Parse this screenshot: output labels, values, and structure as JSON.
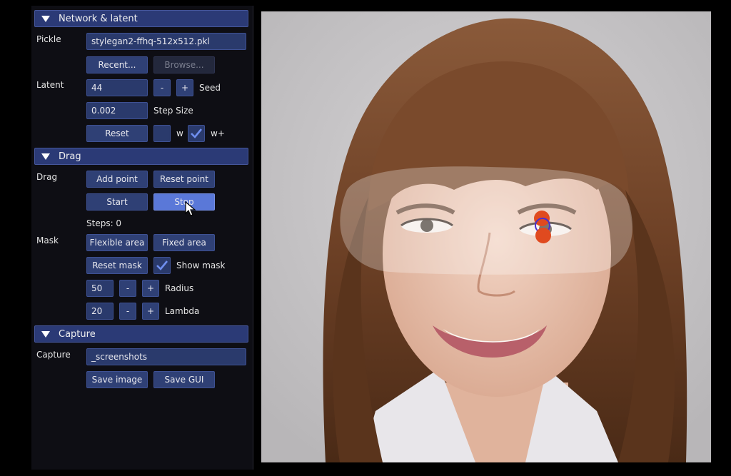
{
  "network": {
    "header": "Network & latent",
    "pickle_label": "Pickle",
    "pickle_value": "stylegan2-ffhq-512x512.pkl",
    "recent_label": "Recent...",
    "browse_label": "Browse...",
    "latent_label": "Latent",
    "latent_value": "44",
    "minus": "-",
    "plus": "+",
    "seed_label": "Seed",
    "step_value": "0.002",
    "step_label": "Step Size",
    "reset_label": "Reset",
    "w_label": "w",
    "wplus_label": "w+",
    "w_checked": false,
    "wplus_checked": true
  },
  "drag": {
    "header": "Drag",
    "drag_label": "Drag",
    "add_point": "Add point",
    "reset_point": "Reset point",
    "start": "Start",
    "stop": "Stop",
    "steps_text": "Steps: 0",
    "mask_label": "Mask",
    "flexible_area": "Flexible area",
    "fixed_area": "Fixed area",
    "reset_mask": "Reset mask",
    "show_mask_label": "Show mask",
    "show_mask_checked": true,
    "radius_value": "50",
    "radius_label": "Radius",
    "lambda_value": "20",
    "lambda_label": "Lambda",
    "minus": "-",
    "plus": "+"
  },
  "capture": {
    "header": "Capture",
    "capture_label": "Capture",
    "dir_value": "_screenshots",
    "save_image": "Save image",
    "save_gui": "Save GUI"
  },
  "colors": {
    "header_bg": "#2b3a76",
    "button_bg": "#2f4075",
    "active_button": "#5a78d8",
    "point_color": "#e04a1f",
    "target_ring": "#4a2fd0"
  }
}
